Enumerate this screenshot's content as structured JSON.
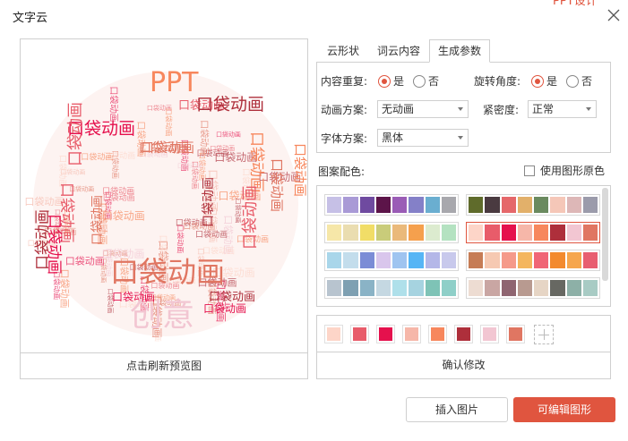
{
  "dialog": {
    "title": "文字云",
    "corner_text": "PPT设计"
  },
  "preview": {
    "refresh_label": "点击刷新预览图",
    "words": {
      "main": "口袋动画",
      "ppt": "PPT",
      "creative": "创意"
    }
  },
  "tabs": [
    {
      "label": "云形状",
      "active": false
    },
    {
      "label": "词云内容",
      "active": false
    },
    {
      "label": "生成参数",
      "active": true
    }
  ],
  "params": {
    "repeat": {
      "label": "内容重复:",
      "yes": "是",
      "no": "否",
      "selected": "是"
    },
    "rotation": {
      "label": "旋转角度:",
      "yes": "是",
      "no": "否",
      "selected": "是"
    },
    "animation": {
      "label": "动画方案:",
      "value": "无动画"
    },
    "density": {
      "label": "紧密度:",
      "value": "正常"
    },
    "font": {
      "label": "字体方案:",
      "value": "黑体"
    }
  },
  "scheme": {
    "label": "图案配色:",
    "use_original_label": "使用图形原色",
    "use_original_checked": false,
    "palettes": [
      [
        "#c6c0e6",
        "#a99ad6",
        "#6f4aa0",
        "#5c1449",
        "#9a5cb6",
        "#8480c8",
        "#6aaed0",
        "#a8a8ad"
      ],
      [
        "#5f6b2b",
        "#4a3a40",
        "#e5676a",
        "#e2b06a",
        "#6a8a5f",
        "#f5c7b8",
        "#ddb7b7",
        "#9b9bab"
      ],
      [
        "#f6e7a8",
        "#eaddb0",
        "#f1dd67",
        "#c9cc7a",
        "#eab97a",
        "#f5a04d",
        "#dcebcf",
        "#b4e2c1"
      ],
      [
        "#fdd5c8",
        "#e85c6a",
        "#e5114d",
        "#f6b7a9",
        "#f7875d",
        "#ae2f3b",
        "#f2c6d2",
        "#e07662"
      ],
      [
        "#a9d6ea",
        "#c3ddec",
        "#7b8cd6",
        "#d9c6ec",
        "#9fc4f0",
        "#56b5f5",
        "#b4b7e8",
        "#c8c9ec"
      ],
      [
        "#c67c55",
        "#f6c9b2",
        "#f59a8a",
        "#f4b65e",
        "#f06576",
        "#f38a2e",
        "#f6a64d",
        "#e85e70"
      ],
      [
        "#b8c4cf",
        "#7ea0b2",
        "#8ab3c6",
        "#c5d8e2",
        "#afe0ea",
        "#a6d3e0",
        "#7ec3b6",
        "#8fcfc8"
      ],
      [
        "#eddcd2",
        "#c9a6a3",
        "#8f6571",
        "#b89a90",
        "#e6d5c5",
        "#676862",
        "#8db0a7",
        "#a8cbc4"
      ]
    ],
    "selected_index": 3
  },
  "current_colors": [
    "#fdd5c8",
    "#e85c6a",
    "#e5114d",
    "#f6b7a9",
    "#f7875d",
    "#ae2f3b",
    "#f2c6d2",
    "#e07662"
  ],
  "confirm_label": "确认修改",
  "buttons": {
    "insert": "插入图片",
    "edit": "可编辑图形"
  },
  "colors": {
    "accent": "#e0553f",
    "border": "#cfcfcf"
  }
}
